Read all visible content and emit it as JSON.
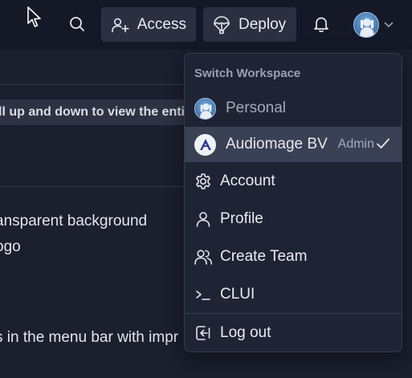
{
  "header": {
    "access_label": "Access",
    "deploy_label": "Deploy"
  },
  "background": {
    "notice_text": "ll up and down to view the entire",
    "line1": "ansparent background",
    "line2": "ogo",
    "line3": "s in the menu bar with impr"
  },
  "dropdown": {
    "header": "Switch Workspace",
    "workspaces": [
      {
        "name": "Personal",
        "role": "",
        "active": false
      },
      {
        "name": "Audiomage BV",
        "role": "Admin",
        "active": true
      }
    ],
    "items": [
      {
        "label": "Account",
        "icon": "gear-icon"
      },
      {
        "label": "Profile",
        "icon": "user-icon"
      },
      {
        "label": "Create Team",
        "icon": "users-icon"
      },
      {
        "label": "CLUI",
        "icon": "terminal-icon"
      },
      {
        "label": "Log out",
        "icon": "logout-icon"
      }
    ]
  },
  "colors": {
    "page_bg": "#1b1f2e",
    "topbar_bg": "#151927",
    "button_bg": "#2a3040",
    "dropdown_bg": "#1f2434",
    "active_row_bg": "#3a4154",
    "muted_text": "#a4aab8"
  }
}
